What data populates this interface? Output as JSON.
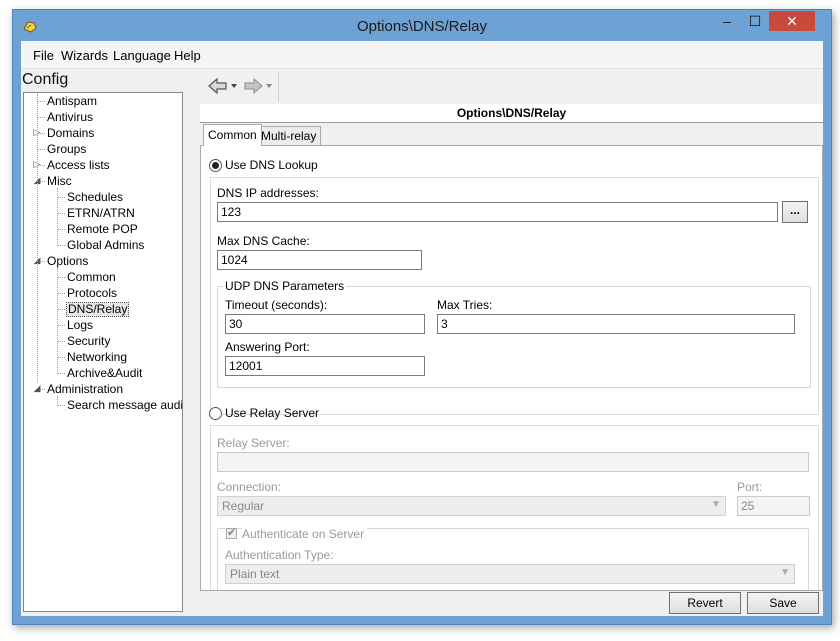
{
  "window": {
    "title": "Options\\DNS/Relay",
    "minimize": "–",
    "maximize": "☐",
    "close": "✕"
  },
  "menu": [
    "File",
    "Wizards",
    "Language",
    "Help"
  ],
  "left": {
    "title": "Config",
    "tree": [
      {
        "label": "Antispam",
        "level": 0
      },
      {
        "label": "Antivirus",
        "level": 0
      },
      {
        "label": "Domains",
        "level": 0,
        "expander": "▷"
      },
      {
        "label": "Groups",
        "level": 0
      },
      {
        "label": "Access lists",
        "level": 0,
        "expander": "▷"
      },
      {
        "label": "Misc",
        "level": 0,
        "expander": "◢"
      },
      {
        "label": "Schedules",
        "level": 1
      },
      {
        "label": "ETRN/ATRN",
        "level": 1
      },
      {
        "label": "Remote POP",
        "level": 1
      },
      {
        "label": "Global Admins",
        "level": 1
      },
      {
        "label": "Options",
        "level": 0,
        "expander": "◢"
      },
      {
        "label": "Common",
        "level": 1
      },
      {
        "label": "Protocols",
        "level": 1
      },
      {
        "label": "DNS/Relay",
        "level": 1,
        "selected": true
      },
      {
        "label": "Logs",
        "level": 1
      },
      {
        "label": "Security",
        "level": 1
      },
      {
        "label": "Networking",
        "level": 1
      },
      {
        "label": "Archive&Audit",
        "level": 1
      },
      {
        "label": "Administration",
        "level": 0,
        "expander": "◢"
      },
      {
        "label": "Search message audit",
        "level": 1
      }
    ]
  },
  "toolbar": {
    "back_icon": "back-arrow-icon",
    "forward_icon": "forward-arrow-icon",
    "dropdown": "▾"
  },
  "header": {
    "title": "Options\\DNS/Relay"
  },
  "tabs": [
    {
      "label": "Common",
      "active": true
    },
    {
      "label": "Multi-relay",
      "active": false
    }
  ],
  "dns": {
    "radio_label": "Use DNS Lookup",
    "ip_label": "DNS IP addresses:",
    "ip_value": "123",
    "browse_button": "...",
    "cache_label": "Max DNS Cache:",
    "cache_value": "1024",
    "udp_title": "UDP DNS Parameters",
    "timeout_label": "Timeout (seconds):",
    "timeout_value": "30",
    "maxtries_label": "Max Tries:",
    "maxtries_value": "3",
    "port_label": "Answering Port:",
    "port_value": "12001"
  },
  "relay": {
    "radio_label": "Use Relay Server",
    "server_label": "Relay Server:",
    "server_value": "",
    "connection_label": "Connection:",
    "connection_value": "Regular",
    "port_label": "Port:",
    "port_value": "25",
    "auth_label": "Authenticate on Server",
    "auth_type_label": "Authentication Type:",
    "auth_type_value": "Plain text"
  },
  "buttons": {
    "revert": "Revert",
    "save": "Save"
  }
}
